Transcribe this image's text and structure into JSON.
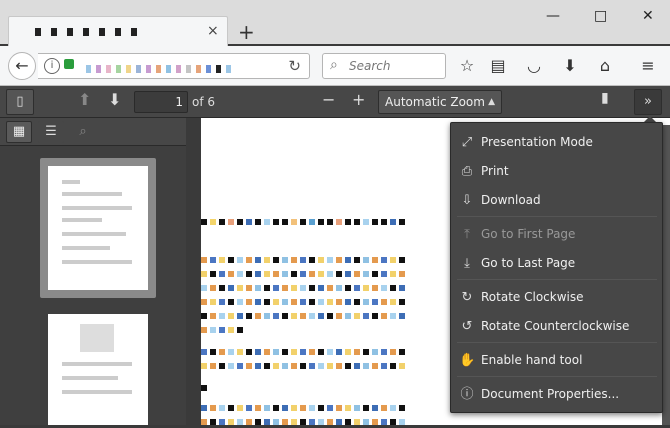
{
  "window": {
    "tab_close_glyph": "×",
    "new_tab_glyph": "+",
    "minimize_glyph": "—",
    "maximize_glyph": "□",
    "close_glyph": "✕"
  },
  "navbar": {
    "back_glyph": "←",
    "info_glyph": "i",
    "reload_glyph": "↻",
    "search_placeholder": "Search",
    "icons": [
      "bookmark-star-icon",
      "reading-list-icon",
      "pocket-icon",
      "download-icon",
      "home-icon",
      "menu-icon"
    ]
  },
  "pdf_toolbar": {
    "page_number": "1",
    "page_count": "of 6",
    "zoom_out_glyph": "−",
    "zoom_in_glyph": "+",
    "zoom_value": "Automatic Zoom",
    "more_glyph": "»"
  },
  "sidebar": {
    "thumbnails_active": true
  },
  "secondary_menu": {
    "items": [
      {
        "label": "Presentation Mode",
        "icon": "fullscreen-icon",
        "glyph": "⤢",
        "enabled": true
      },
      {
        "label": "Print",
        "icon": "print-icon",
        "glyph": "⎙",
        "enabled": true
      },
      {
        "label": "Download",
        "icon": "download-icon",
        "glyph": "⇩",
        "enabled": true
      },
      {
        "label": "Go to First Page",
        "icon": "first-page-icon",
        "glyph": "⤒",
        "enabled": false
      },
      {
        "label": "Go to Last Page",
        "icon": "last-page-icon",
        "glyph": "⤓",
        "enabled": true
      },
      {
        "label": "Rotate Clockwise",
        "icon": "rotate-cw-icon",
        "glyph": "↻",
        "enabled": true
      },
      {
        "label": "Rotate Counterclockwise",
        "icon": "rotate-ccw-icon",
        "glyph": "↺",
        "enabled": true
      },
      {
        "label": "Enable hand tool",
        "icon": "hand-icon",
        "glyph": "✋",
        "enabled": true
      },
      {
        "label": "Document Properties...",
        "icon": "info-icon",
        "glyph": "ⓘ",
        "enabled": true
      }
    ]
  },
  "colors": {
    "toolbar": "#474747",
    "menu_text": "#f0f0f0",
    "disabled_text": "#999999",
    "lock_green": "#2a9d3c"
  }
}
